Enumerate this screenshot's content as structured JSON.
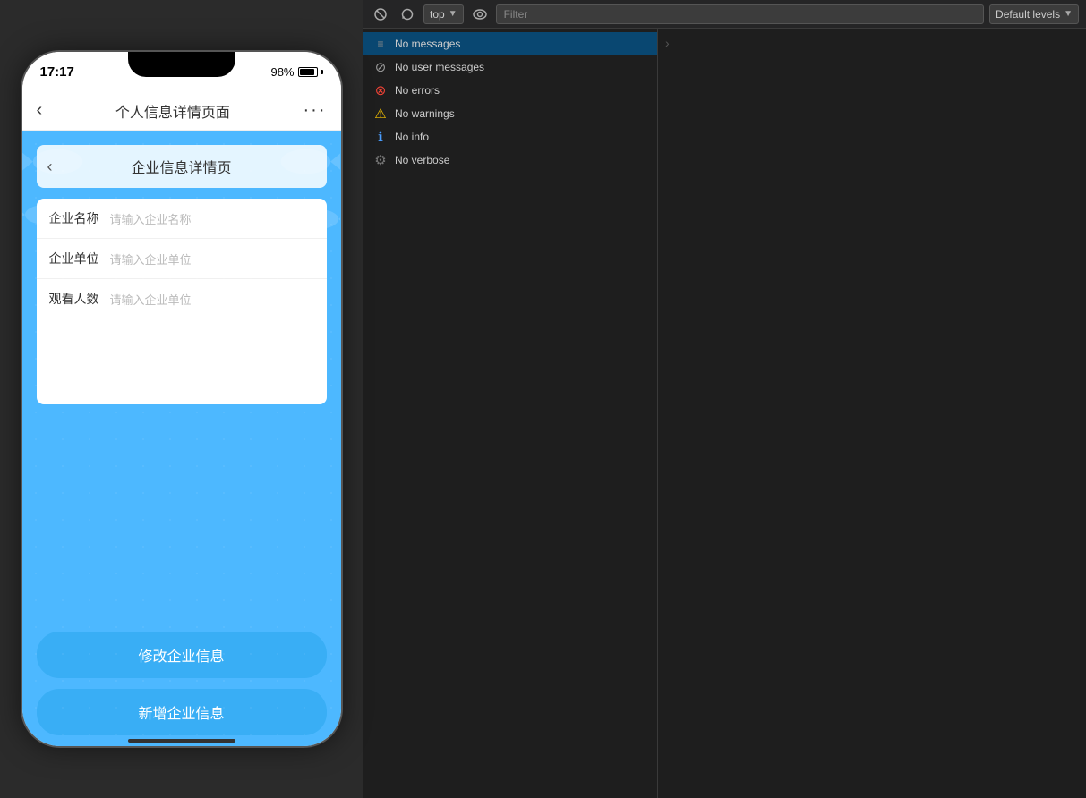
{
  "phone": {
    "statusBar": {
      "time": "17:17",
      "battery": "98%"
    },
    "nav": {
      "title": "个人信息详情页面",
      "backLabel": "‹",
      "dotsLabel": "···"
    },
    "card": {
      "title": "企业信息详情页",
      "backArrow": "‹"
    },
    "formFields": [
      {
        "label": "企业名称",
        "placeholder": "请输入企业名称"
      },
      {
        "label": "企业单位",
        "placeholder": "请输入企业单位"
      },
      {
        "label": "观看人数",
        "placeholder": "请输入企业单位"
      }
    ],
    "buttons": {
      "modify": "修改企业信息",
      "add": "新增企业信息"
    }
  },
  "devtools": {
    "toolbar": {
      "contextValue": "top",
      "filterPlaceholder": "Filter",
      "levelValue": "Default levels"
    },
    "messages": [
      {
        "id": "no-messages",
        "iconType": "messages",
        "iconSymbol": "≡",
        "text": "No messages",
        "selected": true
      },
      {
        "id": "no-user-messages",
        "iconType": "user",
        "iconSymbol": "⊘",
        "text": "No user messages"
      },
      {
        "id": "no-errors",
        "iconType": "error",
        "iconSymbol": "⊗",
        "text": "No errors"
      },
      {
        "id": "no-warnings",
        "iconType": "warning",
        "iconSymbol": "⚠",
        "text": "No warnings"
      },
      {
        "id": "no-info",
        "iconType": "info",
        "iconSymbol": "ℹ",
        "text": "No info"
      },
      {
        "id": "no-verbose",
        "iconType": "verbose",
        "iconSymbol": "⚙",
        "text": "No verbose"
      }
    ]
  }
}
